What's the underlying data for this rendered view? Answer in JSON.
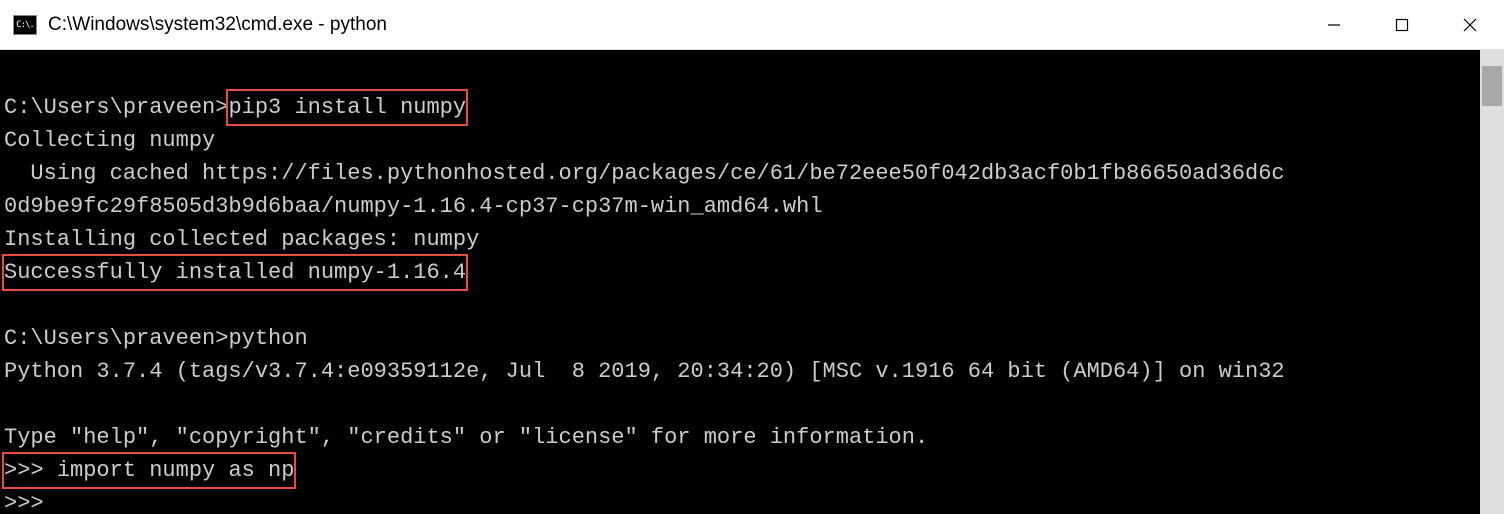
{
  "window": {
    "title": "C:\\Windows\\system32\\cmd.exe - python",
    "icon_label": "C:\\."
  },
  "terminal": {
    "prompt1": "C:\\Users\\praveen>",
    "cmd1": "pip3 install numpy",
    "collect": "Collecting numpy",
    "cached": "  Using cached https://files.pythonhosted.org/packages/ce/61/be72eee50f042db3acf0b1fb86650ad36d6c",
    "cached2": "0d9be9fc29f8505d3b9d6baa/numpy-1.16.4-cp37-cp37m-win_amd64.whl",
    "installing": "Installing collected packages: numpy",
    "success": "Successfully installed numpy-1.16.4",
    "prompt2": "C:\\Users\\praveen>",
    "cmd2": "python",
    "pyver": "Python 3.7.4 (tags/v3.7.4:e09359112e, Jul  8 2019, 20:34:20) [MSC v.1916 64 bit (AMD64)] on win32",
    "help": "Type \"help\", \"copyright\", \"credits\" or \"license\" for more information.",
    "repl1_prompt": ">>> ",
    "repl1_cmd": "import numpy as np",
    "repl2": ">>>"
  }
}
